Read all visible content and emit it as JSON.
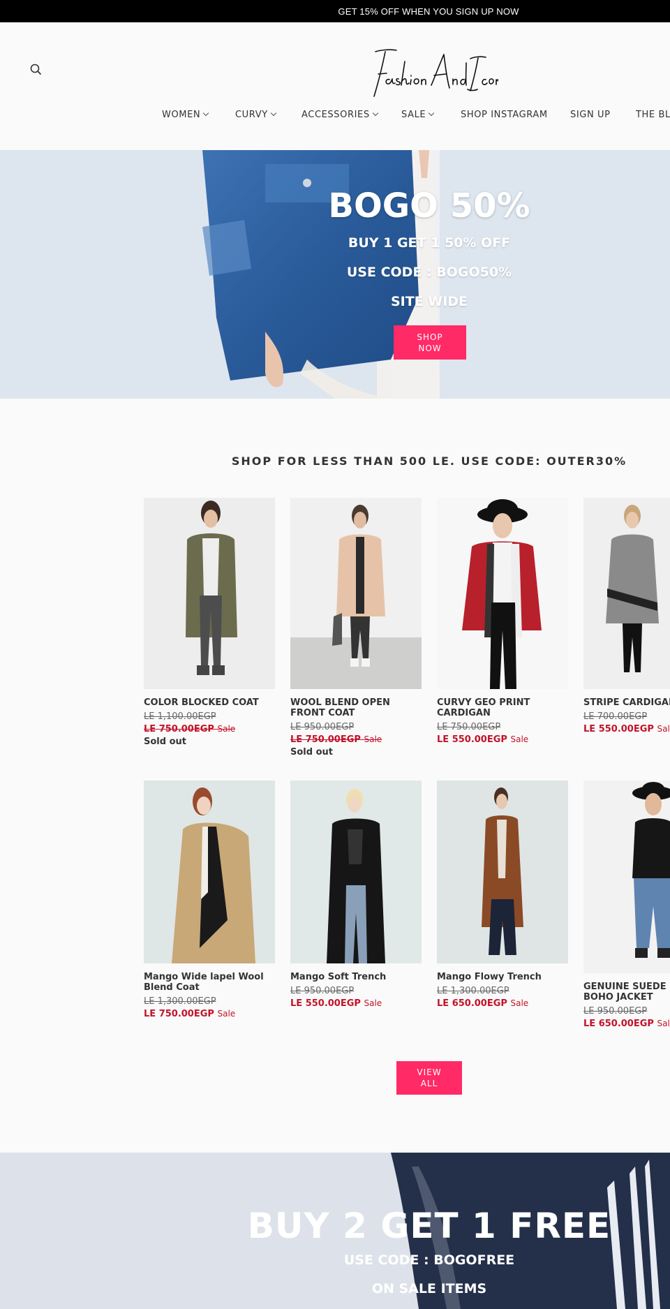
{
  "announcement": "GET 15% OFF WHEN YOU SIGN UP NOW",
  "header": {
    "logo_text": "Fashion And Icon",
    "nav": [
      {
        "label": "WOMEN",
        "dropdown": true
      },
      {
        "label": "CURVY",
        "dropdown": true
      },
      {
        "label": "ACCESSORIES",
        "dropdown": true
      },
      {
        "label": "SALE",
        "dropdown": true
      },
      {
        "label": "SHOP INSTAGRAM",
        "dropdown": false
      },
      {
        "label": "SIGN UP",
        "dropdown": false
      },
      {
        "label": "THE BLOG",
        "dropdown": false
      }
    ]
  },
  "hero": {
    "title": "BOGO 50%",
    "line1": "BUY 1 GET 1 50% OFF",
    "line2": "USE CODE : BOGO50%",
    "line3": "SITE WIDE",
    "button_l1": "SHOP",
    "button_l2": "NOW"
  },
  "collection": {
    "title": "SHOP FOR LESS THAN 500 LE. USE CODE: OUTER30%",
    "products": [
      {
        "title": "COLOR BLOCKED COAT",
        "old_price": "LE 1,100.00EGP",
        "new_price": "LE 750.00EGP",
        "sale": "Sale",
        "sold_out": "Sold out",
        "struck_sale": true
      },
      {
        "title": "WOOL BLEND OPEN FRONT COAT",
        "old_price": "LE 950.00EGP",
        "new_price": "LE 750.00EGP",
        "sale": "Sale",
        "sold_out": "Sold out",
        "struck_sale": true
      },
      {
        "title": "CURVY GEO PRINT CARDIGAN",
        "old_price": "LE 750.00EGP",
        "new_price": "LE 550.00EGP",
        "sale": "Sale",
        "sold_out": ""
      },
      {
        "title": "STRIPE CARDIGAN",
        "old_price": "LE 700.00EGP",
        "new_price": "LE 550.00EGP",
        "sale": "Sale",
        "sold_out": ""
      },
      {
        "title": "Mango Wide lapel Wool Blend Coat",
        "old_price": "LE 1,300.00EGP",
        "new_price": "LE 750.00EGP",
        "sale": "Sale",
        "sold_out": ""
      },
      {
        "title": "Mango Soft Trench",
        "old_price": "LE 950.00EGP",
        "new_price": "LE 550.00EGP",
        "sale": "Sale",
        "sold_out": ""
      },
      {
        "title": "Mango Flowy Trench",
        "old_price": "LE 1,300.00EGP",
        "new_price": "LE 650.00EGP",
        "sale": "Sale",
        "sold_out": ""
      },
      {
        "title": "GENUINE SUEDE FRINGE BOHO JACKET",
        "old_price": "LE 950.00EGP",
        "new_price": "LE 650.00EGP",
        "sale": "Sale",
        "sold_out": ""
      }
    ],
    "view_all_l1": "VIEW",
    "view_all_l2": "ALL"
  },
  "promo2": {
    "title": "BUY 2 GET 1 FREE",
    "line1": "USE CODE : BOGOFREE",
    "line2": "ON SALE ITEMS"
  },
  "colors": {
    "accent": "#ff2a66",
    "sale_red": "#c2142a"
  }
}
